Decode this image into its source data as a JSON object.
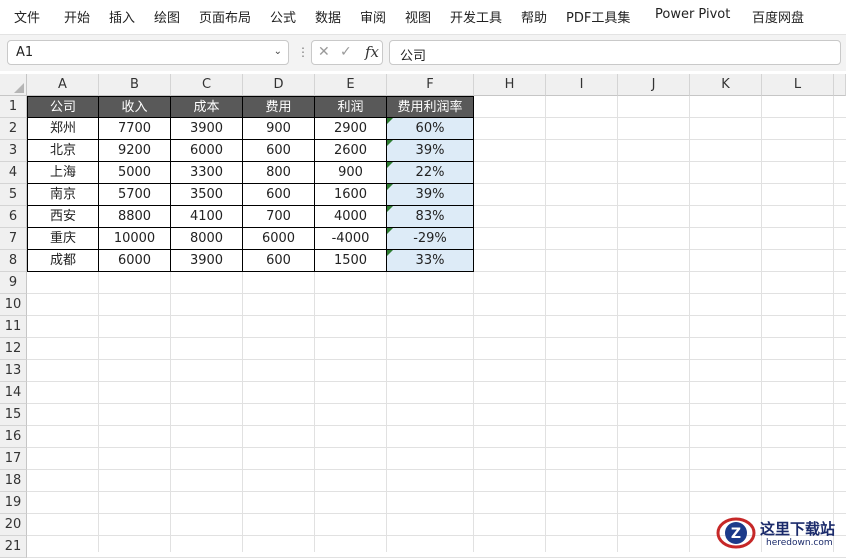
{
  "menu": [
    "文件",
    "开始",
    "插入",
    "绘图",
    "页面布局",
    "公式",
    "数据",
    "审阅",
    "视图",
    "开发工具",
    "帮助",
    "PDF工具集",
    "Power Pivot",
    "百度网盘"
  ],
  "formula_bar": {
    "name_box": "A1",
    "name_box_arrow": "⌄",
    "separator": "⋮",
    "cancel_icon": "✕",
    "enter_icon": "✓",
    "fx_label": "fx",
    "formula": "公司"
  },
  "columns": [
    "A",
    "B",
    "C",
    "D",
    "E",
    "F",
    "H",
    "I",
    "J",
    "K",
    "L"
  ],
  "rows": [
    "1",
    "2",
    "3",
    "4",
    "5",
    "6",
    "7",
    "8",
    "9",
    "10",
    "11",
    "12",
    "13",
    "14",
    "15",
    "16",
    "17",
    "18",
    "19",
    "20",
    "21"
  ],
  "table": {
    "headers": [
      "公司",
      "收入",
      "成本",
      "费用",
      "利润",
      "费用利润率"
    ],
    "rows": [
      [
        "郑州",
        "7700",
        "3900",
        "900",
        "2900",
        "60%"
      ],
      [
        "北京",
        "9200",
        "6000",
        "600",
        "2600",
        "39%"
      ],
      [
        "上海",
        "5000",
        "3300",
        "800",
        "900",
        "22%"
      ],
      [
        "南京",
        "5700",
        "3500",
        "600",
        "1600",
        "39%"
      ],
      [
        "西安",
        "8800",
        "4100",
        "700",
        "4000",
        "83%"
      ],
      [
        "重庆",
        "10000",
        "8000",
        "6000",
        "-4000",
        "-29%"
      ],
      [
        "成都",
        "6000",
        "3900",
        "600",
        "1500",
        "33%"
      ]
    ]
  },
  "watermark": {
    "logo_letter": "Z",
    "title": "这里下载站",
    "url": "heredown.com"
  },
  "colors": {
    "header_fill": "#595959",
    "percent_fill": "#ddebf7",
    "error_indicator": "#2e7d32"
  }
}
